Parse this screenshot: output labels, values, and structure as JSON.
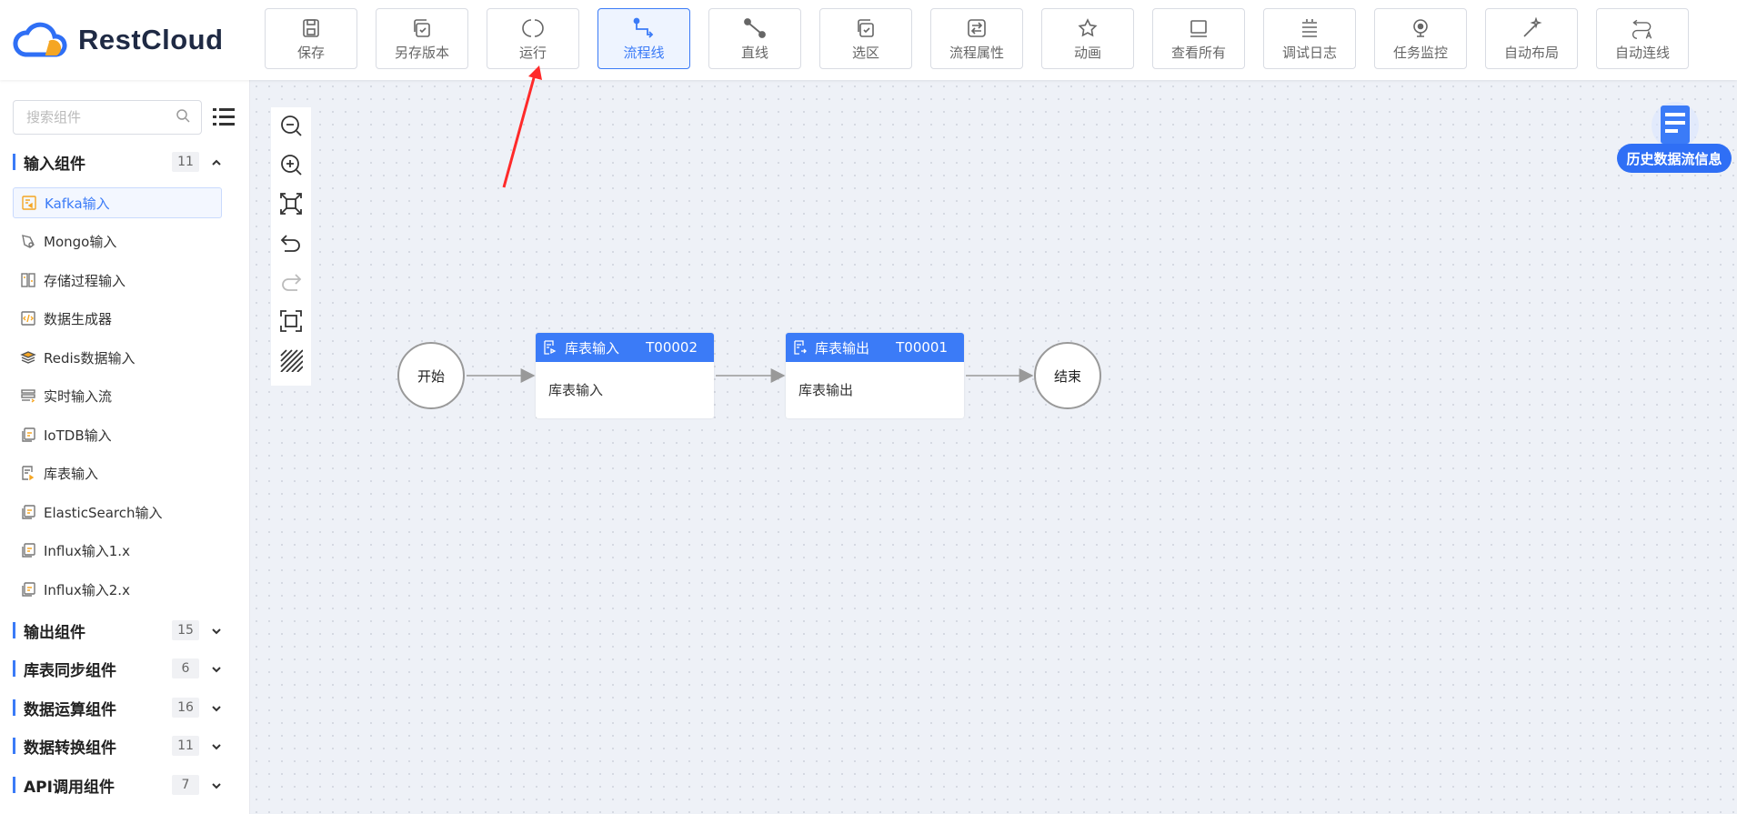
{
  "app": {
    "logo_text": "RestCloud"
  },
  "toolbar": [
    {
      "label": "保存",
      "icon": "save-icon"
    },
    {
      "label": "另存版本",
      "icon": "save-version-icon"
    },
    {
      "label": "运行",
      "icon": "run-icon"
    },
    {
      "label": "流程线",
      "icon": "flow-line-icon",
      "active": true
    },
    {
      "label": "直线",
      "icon": "straight-line-icon"
    },
    {
      "label": "选区",
      "icon": "selection-icon"
    },
    {
      "label": "流程属性",
      "icon": "flow-properties-icon"
    },
    {
      "label": "动画",
      "icon": "animation-icon"
    },
    {
      "label": "查看所有",
      "icon": "view-all-icon"
    },
    {
      "label": "调试日志",
      "icon": "debug-log-icon"
    },
    {
      "label": "任务监控",
      "icon": "task-monitor-icon"
    },
    {
      "label": "自动布局",
      "icon": "auto-layout-icon"
    },
    {
      "label": "自动连线",
      "icon": "auto-connect-icon"
    }
  ],
  "sidebar": {
    "search_placeholder": "搜索组件",
    "groups": [
      {
        "title": "输入组件",
        "count": "11",
        "expanded": true
      },
      {
        "title": "输出组件",
        "count": "15"
      },
      {
        "title": "库表同步组件",
        "count": "6"
      },
      {
        "title": "数据运算组件",
        "count": "16"
      },
      {
        "title": "数据转换组件",
        "count": "11"
      },
      {
        "title": "API调用组件",
        "count": "7"
      }
    ],
    "input_items": [
      {
        "label": "Kafka输入",
        "selected": true
      },
      {
        "label": "Mongo输入"
      },
      {
        "label": "存储过程输入"
      },
      {
        "label": "数据生成器"
      },
      {
        "label": "Redis数据输入"
      },
      {
        "label": "实时输入流"
      },
      {
        "label": "IoTDB输入"
      },
      {
        "label": "库表输入"
      },
      {
        "label": "ElasticSearch输入"
      },
      {
        "label": "Influx输入1.x"
      },
      {
        "label": "Influx输入2.x"
      }
    ]
  },
  "flow": {
    "start_label": "开始",
    "end_label": "结束",
    "nodes": [
      {
        "title": "库表输入",
        "id": "T00002",
        "body": "库表输入"
      },
      {
        "title": "库表输出",
        "id": "T00001",
        "body": "库表输出"
      }
    ]
  },
  "history": {
    "label": "历史数据流信息"
  },
  "colors": {
    "primary": "#3b7bf7",
    "annotation_arrow": "#ff2a2a",
    "canvas_bg": "#eef1f7"
  }
}
